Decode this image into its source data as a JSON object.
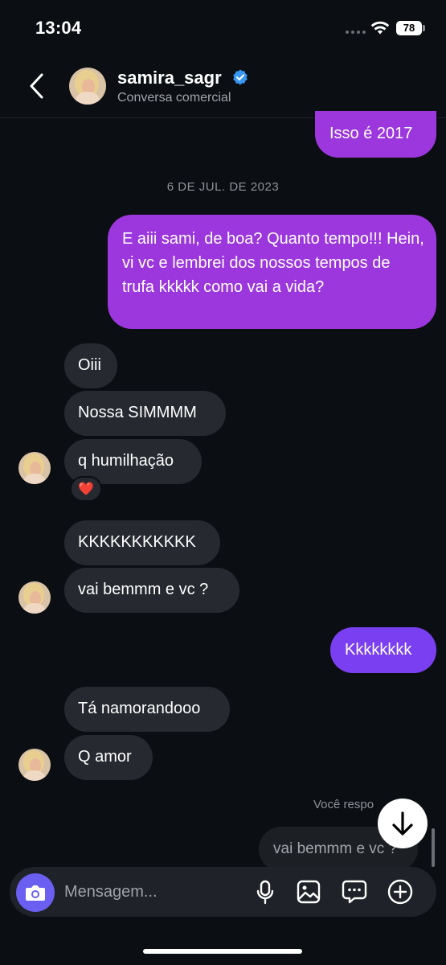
{
  "status_bar": {
    "time": "13:04",
    "battery": "78"
  },
  "header": {
    "username": "samira_sagr",
    "subtitle": "Conversa comercial"
  },
  "messages": {
    "m1": "Isso é 2017",
    "date_separator": "6 DE JUL. DE 2023",
    "m2": "E aiii sami, de boa? Quanto tempo!!! Hein, vi vc e lembrei dos nossos tempos de trufa kkkkk como vai a vida?",
    "m3": "Oiii",
    "m4": "Nossa SIMMMM",
    "m5": "q humilhação",
    "reaction": "❤️",
    "m6": "KKKKKKKKKKK",
    "m7": "vai bemmm e vc ?",
    "m8": "Kkkkkkkk",
    "m9": "Tá namorandooo",
    "m10": "Q amor"
  },
  "reply": {
    "label": "Você respo",
    "quoted": "vai bemmm e vc ?"
  },
  "composer": {
    "placeholder": "Mensagem..."
  },
  "colors": {
    "outgoing": "#9b37dc",
    "outgoing_alt": "#7a3ff0",
    "incoming": "#262a30",
    "background": "#0b0f14",
    "accent": "#6a5ff0"
  }
}
